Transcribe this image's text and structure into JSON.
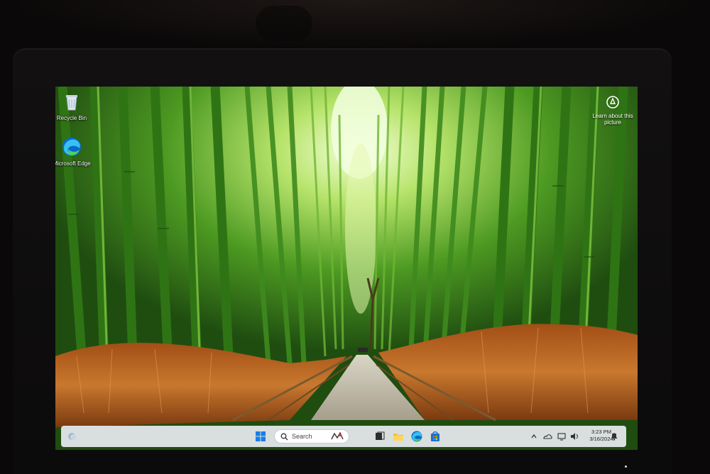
{
  "desktop": {
    "icons": [
      {
        "label": "Recycle Bin",
        "icon": "recycle-bin-icon"
      },
      {
        "label": "Microsoft Edge",
        "icon": "edge-icon"
      }
    ],
    "spotlight_label": "Learn about this picture"
  },
  "taskbar": {
    "search_placeholder": "Search",
    "pinned": [
      "start-icon",
      "search-icon",
      "task-view-icon",
      "file-explorer-icon",
      "edge-icon",
      "store-icon"
    ],
    "tray_icons": [
      "chevron-up-icon",
      "onedrive-icon",
      "network-icon",
      "volume-icon",
      "notification-icon"
    ],
    "time": "3:23 PM",
    "date": "3/16/2024"
  },
  "colors": {
    "bamboo_green": "#3f8a1e",
    "path_light": "#b9b0a0",
    "grass_orange": "#b9621e",
    "taskbar": "#e8ecf0",
    "accent": "#0a67d0"
  }
}
